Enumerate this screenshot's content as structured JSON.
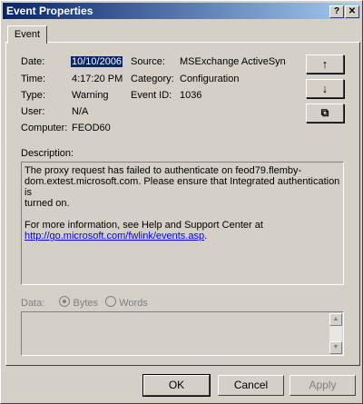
{
  "window": {
    "title": "Event Properties"
  },
  "titlebar": {
    "help_glyph": "?",
    "close_glyph": "✕"
  },
  "tabs": [
    {
      "label": "Event"
    }
  ],
  "event": {
    "date_label": "Date:",
    "date_value": "10/10/2006",
    "time_label": "Time:",
    "time_value": "4:17:20 PM",
    "type_label": "Type:",
    "type_value": "Warning",
    "user_label": "User:",
    "user_value": "N/A",
    "computer_label": "Computer:",
    "computer_value": "FEOD60",
    "source_label": "Source:",
    "source_value": "MSExchange ActiveSyn",
    "category_label": "Category:",
    "category_value": "Configuration",
    "eventid_label": "Event ID:",
    "eventid_value": "1036"
  },
  "sidebuttons": {
    "up_glyph": "↑",
    "down_glyph": "↓",
    "copy_glyph": "⧉"
  },
  "description": {
    "label": "Description:",
    "line1": "The proxy request has failed to authenticate on feod79.flemby-",
    "line2": "dom.extest.microsoft.com. Please ensure that Integrated authentication is",
    "line3": "turned on.",
    "line4": "For more information, see Help and Support Center at",
    "link": "http://go.microsoft.com/fwlink/events.asp",
    "link_suffix": "."
  },
  "data_section": {
    "label": "Data:",
    "bytes_label": "Bytes",
    "words_label": "Words",
    "selected": "Bytes"
  },
  "buttons": {
    "ok": "OK",
    "cancel": "Cancel",
    "apply": "Apply"
  }
}
